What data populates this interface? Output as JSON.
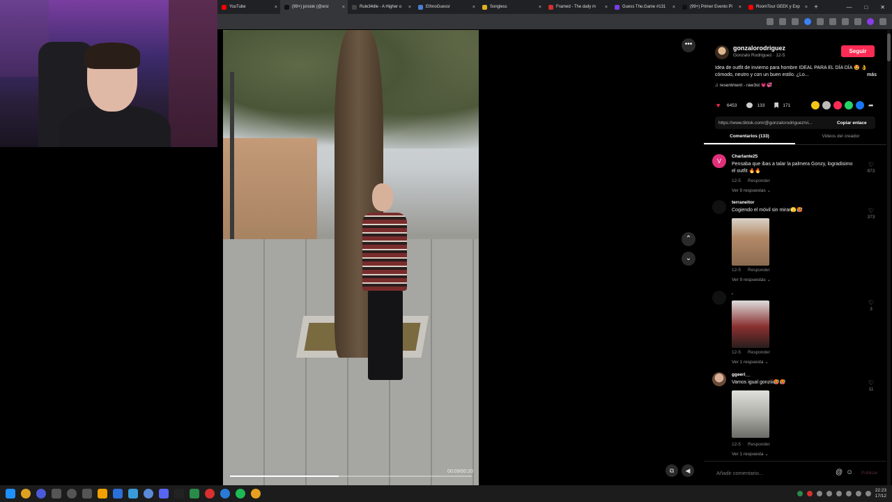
{
  "browser": {
    "tabs": [
      {
        "label": "YouTube",
        "fav_color": "#ff0000"
      },
      {
        "label": "(99+) jorsiok (@orsi",
        "fav_color": "#111111",
        "active": true
      },
      {
        "label": "Rule34dle - A Higher o",
        "fav_color": "#444444"
      },
      {
        "label": "EthnoGuessr",
        "fav_color": "#4a7fd4"
      },
      {
        "label": "Songless",
        "fav_color": "#e0b020"
      },
      {
        "label": "Framed - The daily m",
        "fav_color": "#d03030"
      },
      {
        "label": "Guess The.Game #131",
        "fav_color": "#7a3ce8"
      },
      {
        "label": "(99+) Primer Evento Pl",
        "fav_color": "#111111"
      },
      {
        "label": "RoomTour GEEK y Exp",
        "fav_color": "#ff0000"
      }
    ],
    "new_tab": "+",
    "close_glyph": "×"
  },
  "video": {
    "timer": "00:09/00:20",
    "progress": 0.45
  },
  "post": {
    "username": "gonzalorodriguez",
    "subline": "Gonzalo Rodriguez · 12-5",
    "follow_label": "Seguir",
    "description": "Idea de outfit de invierno para hombre IDEAL PARA EL DÍA DÍA 🤩 👌 cómodo, neutro y con un buen estilo. ¿Lo...",
    "more_label": "más",
    "music": "♫ resentment - raw3st 💗💞",
    "likes": "6453",
    "comments": "133",
    "saves": "171",
    "share_colors": [
      "#f5c518",
      "#bbbbbb",
      "#fe2c55",
      "#25d366",
      "#1877f2"
    ],
    "link": "https://www.tiktok.com/@gonzalorodriguez/vi...",
    "copy_label": "Copiar enlace"
  },
  "tabs": {
    "comments": "Comentarios (133)",
    "creator_videos": "Videos del creador"
  },
  "comments": [
    {
      "user": "Charlante25",
      "text": "Pensaba que ibas a talar la palmera Gonzy, logradisimo el outfit 🔥🔥",
      "date": "12-5",
      "reply": "Responder",
      "replies": "Ver 9 respuestas ⌄",
      "likes": "873",
      "avatar_color": "#e0307a",
      "avatar_letter": "V"
    },
    {
      "user": "terraneitor",
      "text": "Cogiendo el móvil sin mirar🫣🥵",
      "date": "12-5",
      "reply": "Responder",
      "replies": "Ver 9 respuestas ⌄",
      "likes": "373",
      "avatar_color": "#111111"
    },
    {
      "user": ".",
      "text": "",
      "date": "12-5",
      "reply": "Responder",
      "replies": "Ver 1 respuesta ⌄",
      "likes": "3",
      "avatar_color": "#111111"
    },
    {
      "user": "ggeeri__",
      "text": "Vamos igual gonziii🥵🥵",
      "date": "12-5",
      "reply": "Responder",
      "replies": "Ver 1 respuesta ⌄",
      "likes": "11",
      "avatar_color": "#b08070"
    }
  ],
  "comment_input": {
    "placeholder": "Añadir comentario...",
    "at": "@",
    "emoji": "☺",
    "publish": "Publicar"
  },
  "taskbar": {
    "time": "22:23",
    "date": "17/12"
  }
}
